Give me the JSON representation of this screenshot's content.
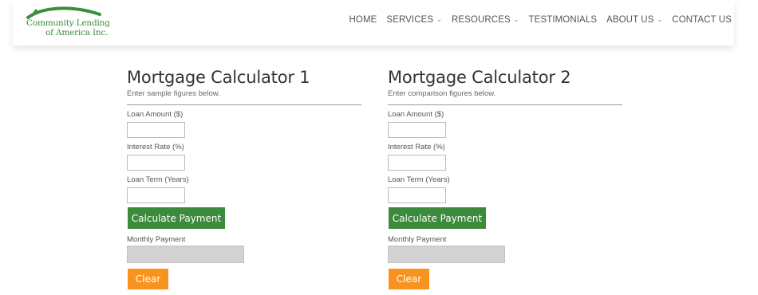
{
  "brand": {
    "line1": "Community Lending",
    "line2": "of America Inc.",
    "color": "#3a8f3a"
  },
  "nav": {
    "items": [
      {
        "label": "HOME",
        "dropdown": false
      },
      {
        "label": "SERVICES",
        "dropdown": true
      },
      {
        "label": "RESOURCES",
        "dropdown": true
      },
      {
        "label": "TESTIMONIALS",
        "dropdown": false
      },
      {
        "label": "ABOUT US",
        "dropdown": true
      },
      {
        "label": "CONTACT US",
        "dropdown": false
      }
    ]
  },
  "calculators": [
    {
      "title": "Mortgage Calculator 1",
      "subtitle": "Enter sample figures below.",
      "loan_amount_label": "Loan Amount ($)",
      "loan_amount_value": "",
      "interest_rate_label": "Interest Rate (%)",
      "interest_rate_value": "",
      "loan_term_label": "Loan Term (Years)",
      "loan_term_value": "",
      "calculate_label": "Calculate Payment",
      "monthly_payment_label": "Monthly Payment",
      "monthly_payment_value": "",
      "clear_label": "Clear"
    },
    {
      "title": "Mortgage Calculator 2",
      "subtitle": "Enter comparison figures below.",
      "loan_amount_label": "Loan Amount ($)",
      "loan_amount_value": "",
      "interest_rate_label": "Interest Rate (%)",
      "interest_rate_value": "",
      "loan_term_label": "Loan Term (Years)",
      "loan_term_value": "",
      "calculate_label": "Calculate Payment",
      "monthly_payment_label": "Monthly Payment",
      "monthly_payment_value": "",
      "clear_label": "Clear"
    }
  ],
  "colors": {
    "calculate_button": "#3c8a3c",
    "clear_button": "#f7931e",
    "output_field": "#d2d2d2"
  }
}
